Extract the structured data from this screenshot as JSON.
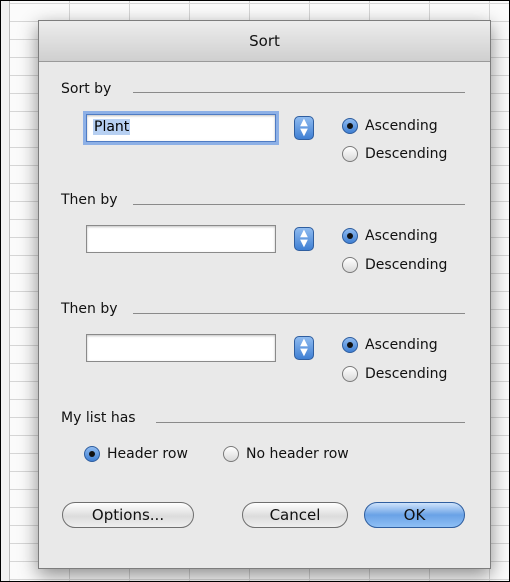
{
  "dialog": {
    "title": "Sort",
    "sort_by_label": "Sort by",
    "then_by_label_1": "Then by",
    "then_by_label_2": "Then by",
    "list_has_label": "My list has"
  },
  "sort_key_1": {
    "value": "Plant",
    "ascending": "Ascending",
    "descending": "Descending",
    "selected": "Ascending"
  },
  "sort_key_2": {
    "value": "",
    "ascending": "Ascending",
    "descending": "Descending",
    "selected": "Ascending"
  },
  "sort_key_3": {
    "value": "",
    "ascending": "Ascending",
    "descending": "Descending",
    "selected": "Ascending"
  },
  "header": {
    "header_row": "Header row",
    "no_header_row": "No header row",
    "selected": "Header row"
  },
  "buttons": {
    "options": "Options...",
    "cancel": "Cancel",
    "ok": "OK"
  },
  "icons": {
    "stepper": "popup-arrows-icon",
    "radio": "radio-icon"
  },
  "colors": {
    "accent": "#3f7fd3",
    "dialog_bg": "#e9e9e9"
  }
}
